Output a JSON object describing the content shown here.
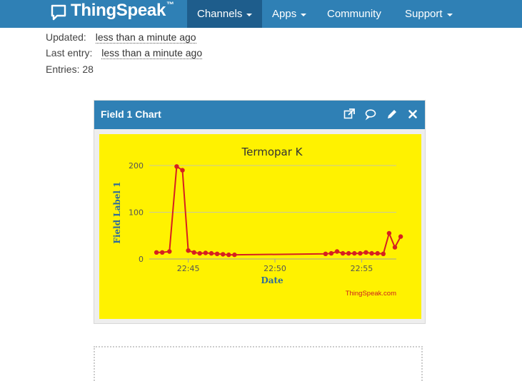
{
  "navbar": {
    "brand": "ThingSpeak",
    "brand_tm": "™",
    "items": [
      {
        "label": "Channels"
      },
      {
        "label": "Apps"
      },
      {
        "label": "Community"
      },
      {
        "label": "Support"
      }
    ]
  },
  "channel_info": {
    "updated_label": "Updated:",
    "updated_value": "less than a minute ago",
    "last_entry_label": "Last entry:",
    "last_entry_value": "less than a minute ago",
    "entries_label": "Entries:",
    "entries_value": "28"
  },
  "panel": {
    "title": "Field 1 Chart",
    "tools": [
      "external-link-icon",
      "comment-icon",
      "pencil-icon",
      "close-icon"
    ]
  },
  "colors": {
    "navbar": "#2f80b5",
    "navbar_active": "#1e5d8c",
    "chart_background": "#fff200",
    "series_line": "#d62020",
    "axis_label": "#2f6d9a"
  },
  "chart_data": {
    "type": "line",
    "title": "Termopar K",
    "xlabel": "Date",
    "ylabel": "Field Label 1",
    "credit": "ThingSpeak.com",
    "x_unit": "minutes",
    "xlim": [
      "22:42:45",
      "22:57:00"
    ],
    "ylim": [
      0,
      200
    ],
    "yticks": [
      0,
      100,
      200
    ],
    "xticks": [
      "22:45",
      "22:50",
      "22:55"
    ],
    "grid": true,
    "series": [
      {
        "points": [
          [
            "22:43:10",
            14
          ],
          [
            "22:43:30",
            14
          ],
          [
            "22:43:55",
            16
          ],
          [
            "22:44:20",
            198
          ],
          [
            "22:44:40",
            190
          ],
          [
            "22:45:00",
            18
          ],
          [
            "22:45:20",
            14
          ],
          [
            "22:45:40",
            12
          ],
          [
            "22:46:00",
            13
          ],
          [
            "22:46:20",
            12
          ],
          [
            "22:46:40",
            11
          ],
          [
            "22:47:00",
            10
          ],
          [
            "22:47:20",
            9
          ],
          [
            "22:47:40",
            9
          ],
          [
            "22:52:55",
            11
          ],
          [
            "22:53:15",
            12
          ],
          [
            "22:53:35",
            16
          ],
          [
            "22:53:55",
            12
          ],
          [
            "22:54:15",
            12
          ],
          [
            "22:54:35",
            12
          ],
          [
            "22:54:55",
            12
          ],
          [
            "22:55:15",
            14
          ],
          [
            "22:55:35",
            12
          ],
          [
            "22:55:55",
            12
          ],
          [
            "22:56:15",
            11
          ],
          [
            "22:56:35",
            55
          ],
          [
            "22:56:55",
            25
          ],
          [
            "22:57:15",
            48
          ]
        ]
      }
    ]
  }
}
